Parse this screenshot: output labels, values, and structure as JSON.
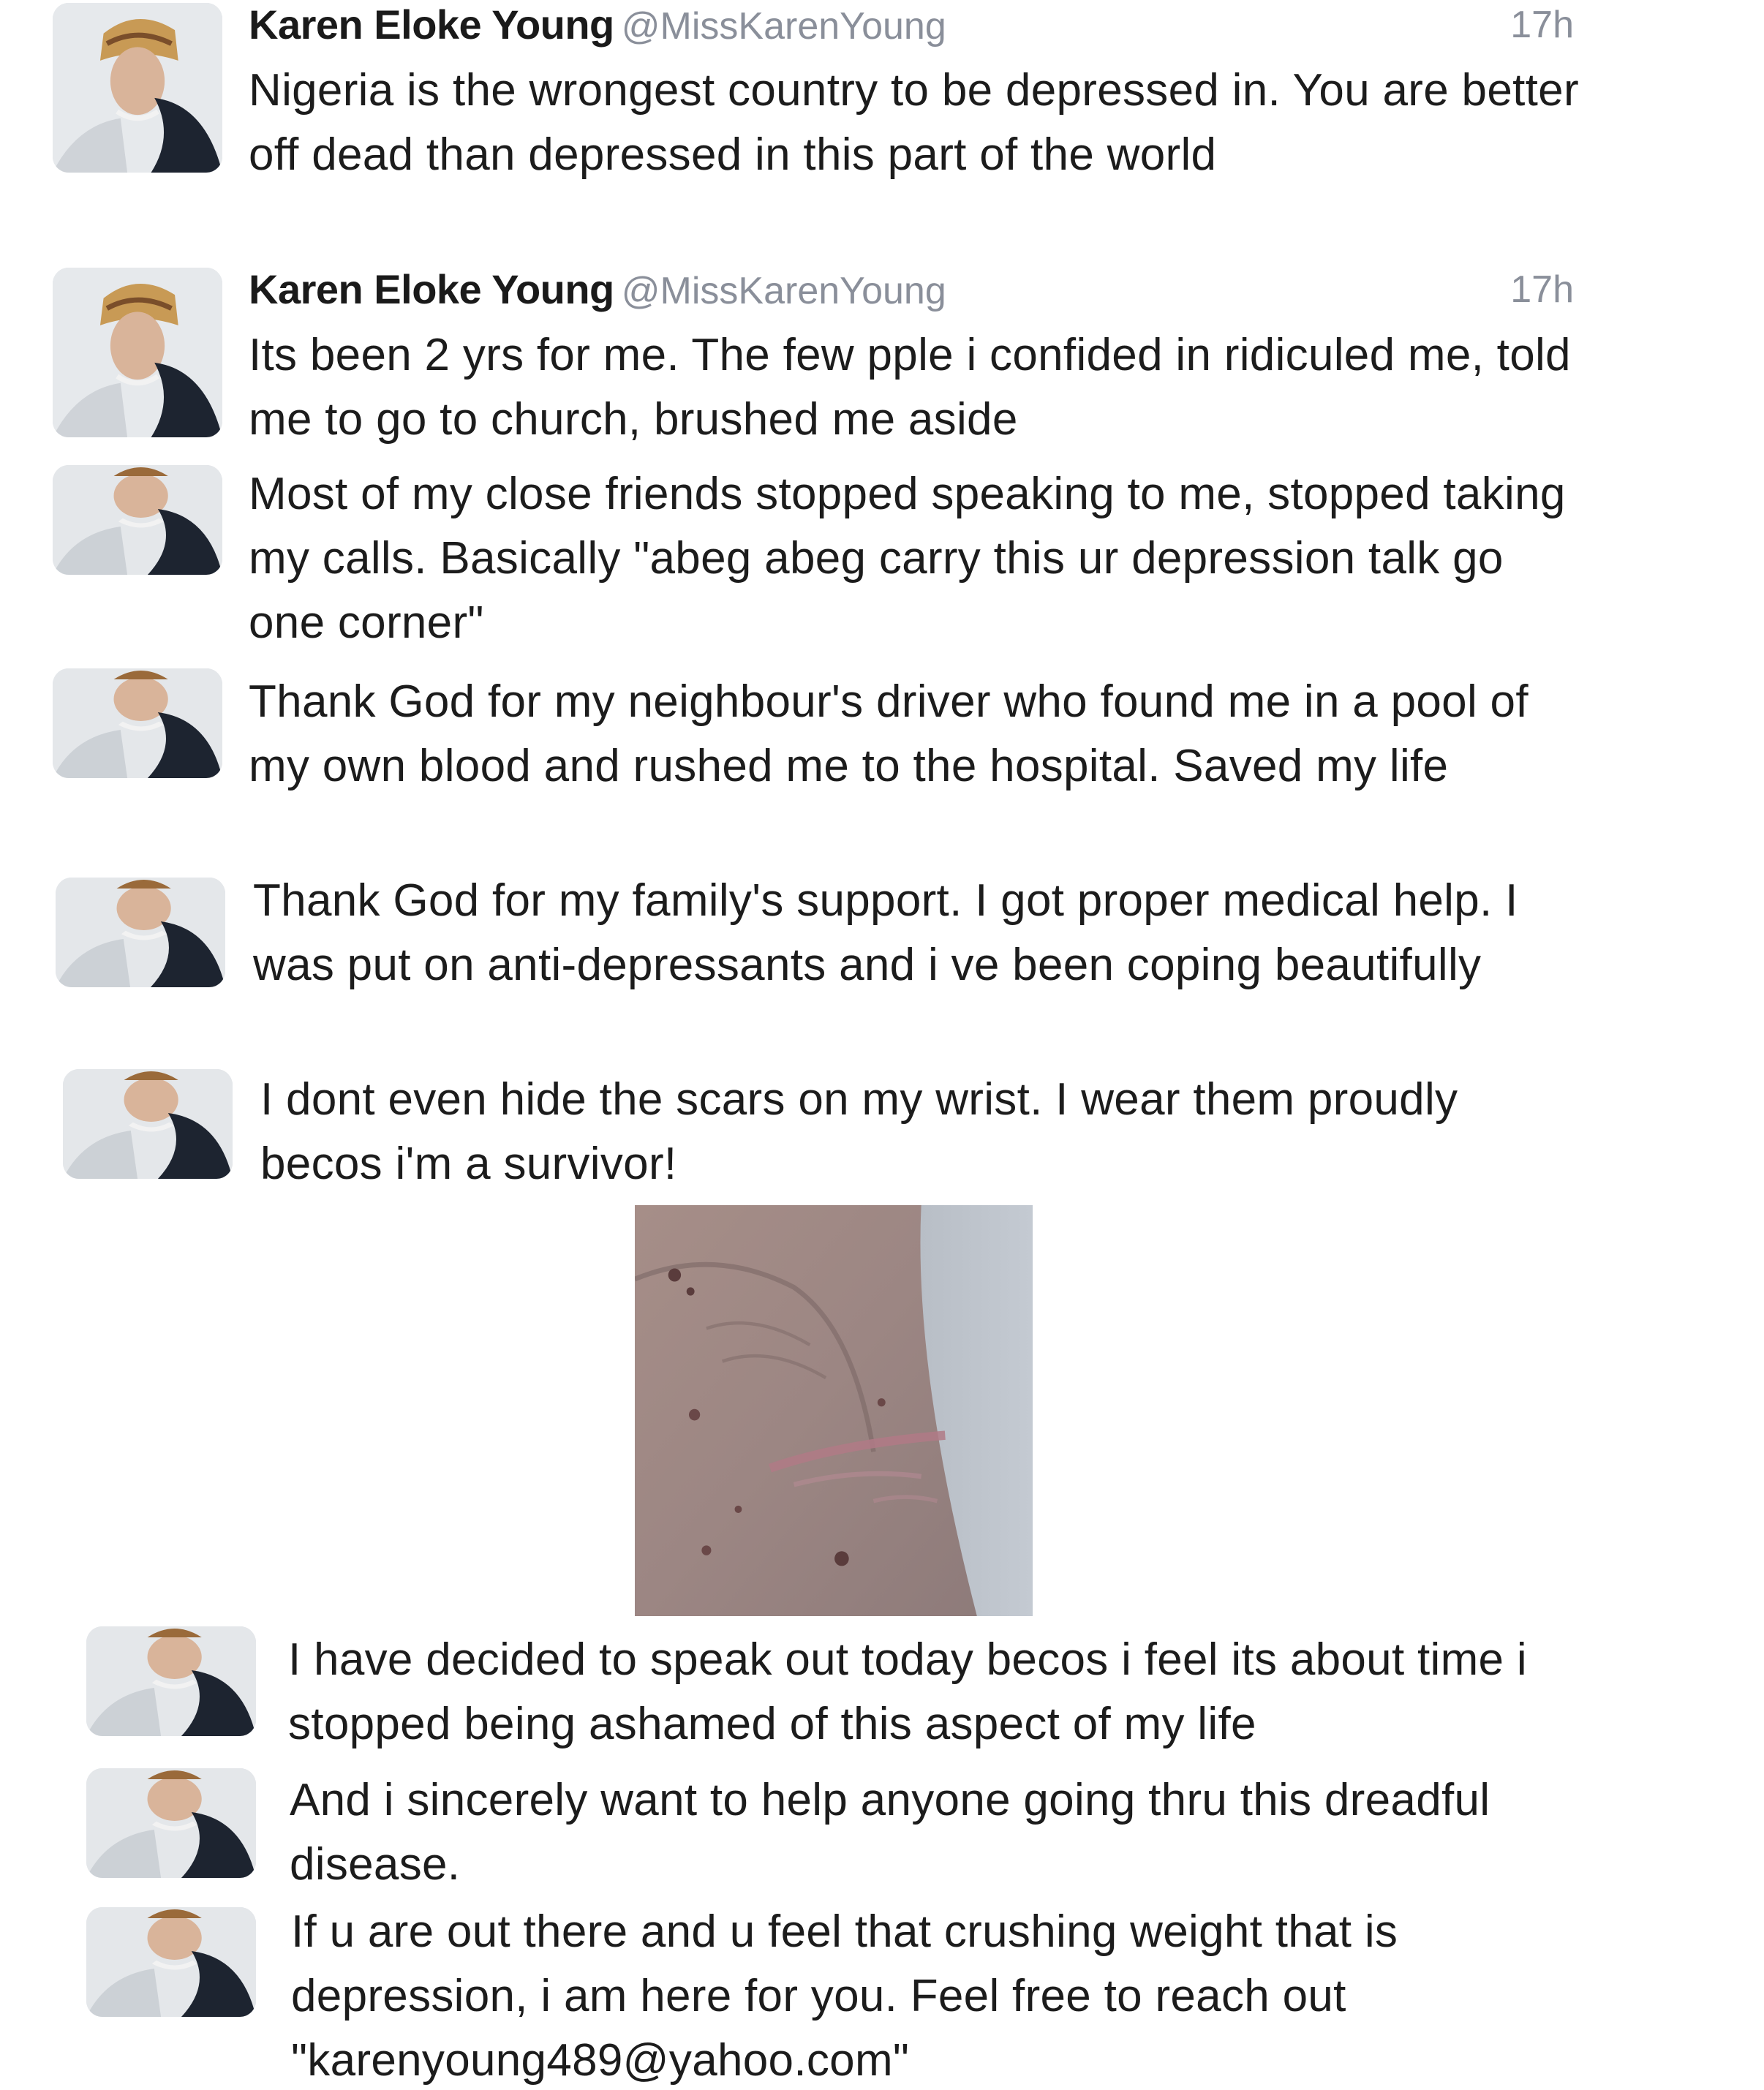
{
  "author": {
    "name": "Karen Eloke Young",
    "handle": "@MissKarenYoung"
  },
  "tweets": [
    {
      "time": "17h",
      "text": "Nigeria is the wrongest country to be depressed in. You are better off dead than depressed in this part of the world"
    },
    {
      "time": "17h",
      "text": "Its been 2 yrs for me. The few pple i confided in ridiculed me, told me to go to church, brushed me aside"
    },
    {
      "text": "Most of my close friends stopped speaking to me, stopped taking my calls. Basically \"abeg abeg carry this ur depression talk go one corner\""
    },
    {
      "text": "Thank God for my neighbour's driver who found me in a pool of my own blood and rushed me to the hospital. Saved my life"
    },
    {
      "text": "Thank God for my family's support. I got proper medical help. I was put on anti-depressants and i ve been coping beautifully"
    },
    {
      "text": "I dont even hide the scars on my wrist. I wear them proudly becos i'm a survivor!"
    },
    {
      "text": "I have decided to speak out today becos i feel its about time i stopped being ashamed of this aspect of my life"
    },
    {
      "text": "And i sincerely want to help anyone going thru this dreadful disease."
    },
    {
      "text": "If u are out there and u feel that crushing weight that is depression, i am here for you. Feel free to reach out \"karenyoung489@yahoo.com\""
    }
  ],
  "icons": {
    "avatar": "profile-photo",
    "attached_photo": "wrist-scar-photo"
  }
}
